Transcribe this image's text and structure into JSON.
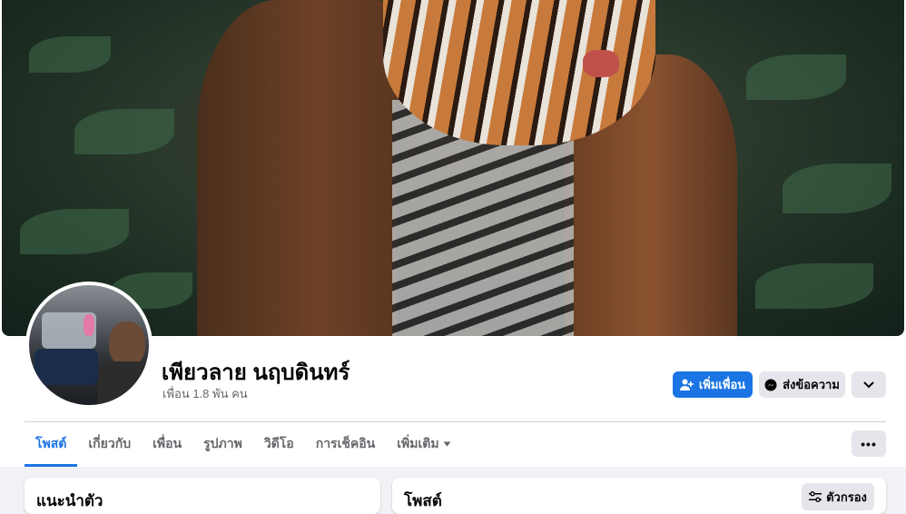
{
  "profile": {
    "name": "เพียวลาย นฤบดินทร์",
    "friends_text": "เพื่อน 1.8 พัน คน"
  },
  "actions": {
    "add_friend": "เพิ่มเพื่อน",
    "message": "ส่งข้อความ",
    "more_icon": "chevron-down-icon"
  },
  "tabs": [
    {
      "label": "โพสต์",
      "active": true
    },
    {
      "label": "เกี่ยวกับ"
    },
    {
      "label": "เพื่อน"
    },
    {
      "label": "รูปภาพ"
    },
    {
      "label": "วิดีโอ"
    },
    {
      "label": "การเช็คอิน"
    },
    {
      "label": "เพิ่มเติม"
    }
  ],
  "tabs_more": "•••",
  "intro": {
    "title": "แนะนำตัว"
  },
  "posts": {
    "title": "โพสต์",
    "filter_label": "ตัวกรอง"
  },
  "colors": {
    "accent": "#1b74e4",
    "button_gray": "#e4e6eb",
    "background": "#f0f2f5"
  }
}
